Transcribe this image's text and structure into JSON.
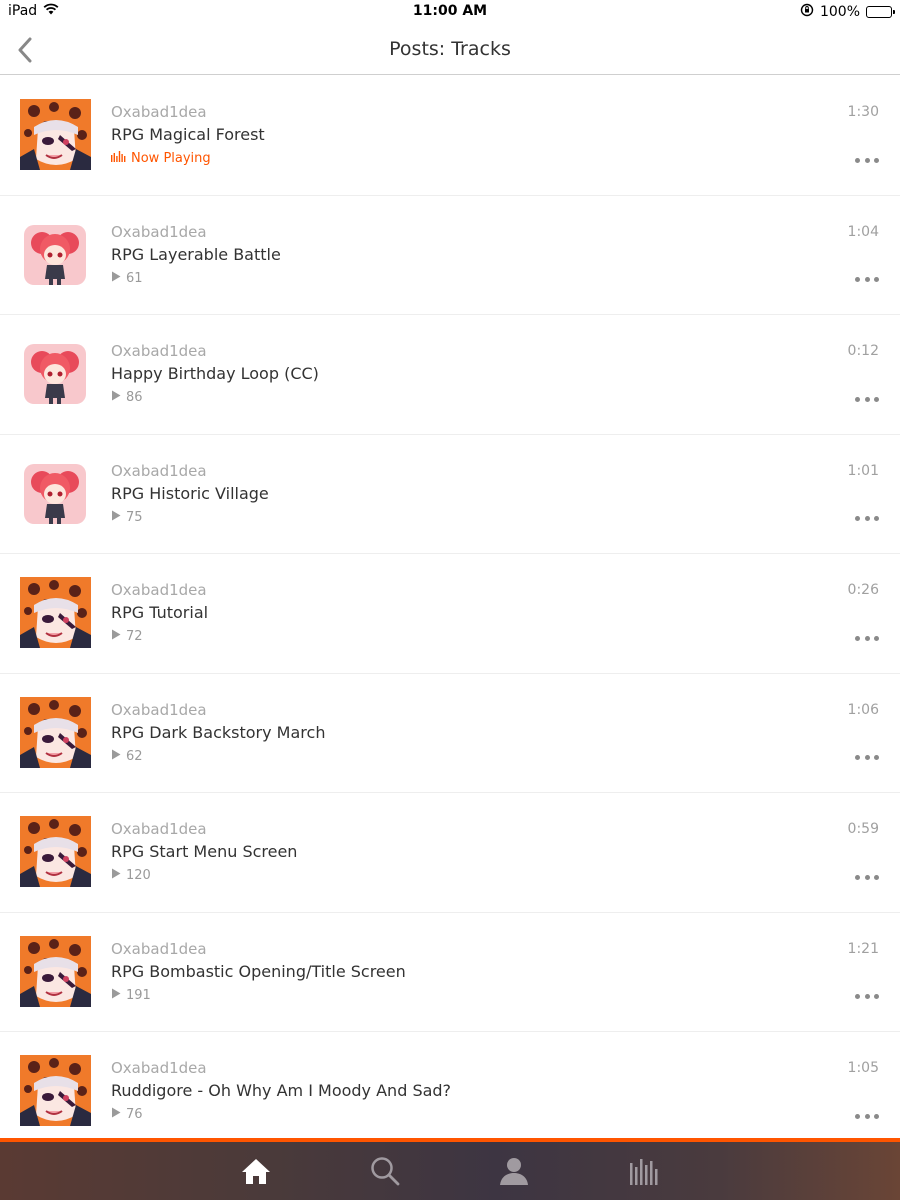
{
  "status_bar": {
    "device": "iPad",
    "time": "11:00 AM",
    "battery": "100%"
  },
  "nav": {
    "title": "Posts: Tracks",
    "back_icon": "chevron-left-icon"
  },
  "tracks": [
    {
      "artist": "Oxabad1dea",
      "title": "RPG Magical Forest",
      "duration": "1:30",
      "status": "Now Playing",
      "plays": null,
      "artwork": "orange"
    },
    {
      "artist": "Oxabad1dea",
      "title": "RPG Layerable Battle",
      "duration": "1:04",
      "status": null,
      "plays": "61",
      "artwork": "pink"
    },
    {
      "artist": "Oxabad1dea",
      "title": "Happy Birthday Loop (CC)",
      "duration": "0:12",
      "status": null,
      "plays": "86",
      "artwork": "pink"
    },
    {
      "artist": "Oxabad1dea",
      "title": "RPG Historic Village",
      "duration": "1:01",
      "status": null,
      "plays": "75",
      "artwork": "pink"
    },
    {
      "artist": "Oxabad1dea",
      "title": "RPG Tutorial",
      "duration": "0:26",
      "status": null,
      "plays": "72",
      "artwork": "orange"
    },
    {
      "artist": "Oxabad1dea",
      "title": "RPG Dark Backstory March",
      "duration": "1:06",
      "status": null,
      "plays": "62",
      "artwork": "orange"
    },
    {
      "artist": "Oxabad1dea",
      "title": "RPG Start Menu Screen",
      "duration": "0:59",
      "status": null,
      "plays": "120",
      "artwork": "orange"
    },
    {
      "artist": "Oxabad1dea",
      "title": "RPG Bombastic Opening/Title Screen",
      "duration": "1:21",
      "status": null,
      "plays": "191",
      "artwork": "orange"
    },
    {
      "artist": "Oxabad1dea",
      "title": "Ruddigore - Oh Why Am I Moody And Sad?",
      "duration": "1:05",
      "status": null,
      "plays": "76",
      "artwork": "orange"
    }
  ],
  "tab_bar": {
    "items": [
      {
        "icon": "home-icon",
        "active": true
      },
      {
        "icon": "search-icon",
        "active": false
      },
      {
        "icon": "profile-icon",
        "active": false
      },
      {
        "icon": "library-icon",
        "active": false
      }
    ]
  },
  "colors": {
    "accent": "#ff5500",
    "artist_text": "#a8a8a8",
    "title_text": "#333333"
  }
}
